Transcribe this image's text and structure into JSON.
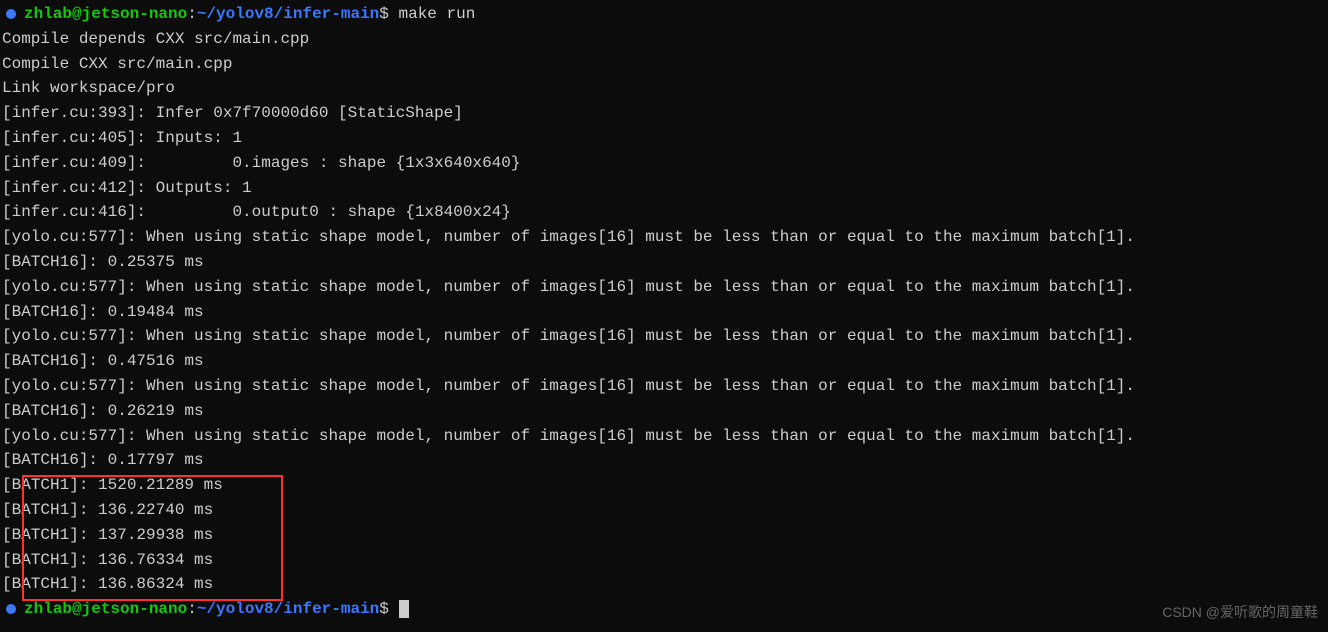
{
  "prompt": {
    "user_host": "zhlab@jetson-nano",
    "separator": ":",
    "path": "~/yolov8/infer-main",
    "dollar": "$"
  },
  "command": "make run",
  "output": {
    "compile_depends": "Compile depends CXX src/main.cpp",
    "compile_cxx": "Compile CXX src/main.cpp",
    "link": "Link workspace/pro",
    "infer_393": "[infer.cu:393]: Infer 0x7f70000d60 [StaticShape]",
    "infer_405": "[infer.cu:405]: Inputs: 1",
    "infer_409": "[infer.cu:409]:         0.images : shape {1x3x640x640}",
    "infer_412": "[infer.cu:412]: Outputs: 1",
    "infer_416": "[infer.cu:416]:         0.output0 : shape {1x8400x24}",
    "yolo_warning": "[yolo.cu:577]: When using static shape model, number of images[16] must be less than or equal to the maximum batch[1].",
    "batch16": [
      "[BATCH16]: 0.25375 ms",
      "[BATCH16]: 0.19484 ms",
      "[BATCH16]: 0.47516 ms",
      "[BATCH16]: 0.26219 ms",
      "[BATCH16]: 0.17797 ms"
    ],
    "batch1": [
      "[BATCH1]: 1520.21289 ms",
      "[BATCH1]: 136.22740 ms",
      "[BATCH1]: 137.29938 ms",
      "[BATCH1]: 136.76334 ms",
      "[BATCH1]: 136.86324 ms"
    ]
  },
  "watermark": "CSDN @爱听歌的周童鞋"
}
